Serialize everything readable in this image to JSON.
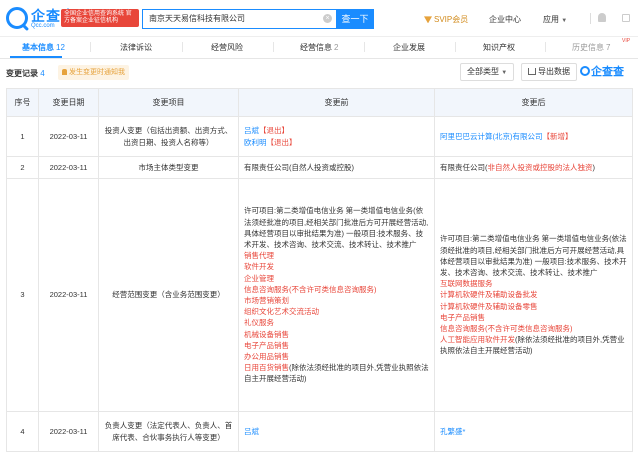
{
  "header": {
    "brand": "企查查",
    "brand_sub": "Qcc.com",
    "badge": "全国企业信用查询系统 官方备案企业征信机构",
    "search_value": "南京天天易信科技有限公司",
    "search_button": "查一下",
    "svip": "SVIP会员",
    "enterprise_center": "企业中心",
    "apps": "应用"
  },
  "tabs": [
    {
      "label": "基本信息",
      "count": "12"
    },
    {
      "label": "法律诉讼",
      "count": ""
    },
    {
      "label": "经营风险",
      "count": ""
    },
    {
      "label": "经营信息",
      "count": "2"
    },
    {
      "label": "企业发展",
      "count": ""
    },
    {
      "label": "知识产权",
      "count": ""
    },
    {
      "label": "历史信息",
      "count": "7"
    }
  ],
  "vip_tag": "VIP",
  "section": {
    "title": "变更记录",
    "count": "4",
    "notify": "发生变更时通知我",
    "filter": "全部类型",
    "export": "导出数据",
    "watermark": "企查查"
  },
  "table": {
    "headers": [
      "序号",
      "变更日期",
      "变更项目",
      "变更前",
      "变更后"
    ],
    "rows": [
      {
        "no": "1",
        "date": "2022-03-11",
        "item": "投资人变更（包括出资额、出资方式、出资日期、投资人名称等）",
        "before": [
          {
            "name": "吕斌",
            "tag": "【退出】"
          },
          {
            "name": "欧利明",
            "tag": "【退出】"
          }
        ],
        "after": [
          {
            "name": "阿里巴巴云计算(北京)有限公司",
            "tag": "【新增】"
          }
        ]
      },
      {
        "no": "2",
        "date": "2022-03-11",
        "item": "市场主体类型变更",
        "before_text": "有限责任公司(自然人投资或控股)",
        "after_prefix": "有限责任公司(",
        "after_hl": "非自然人投资或控股的法人独资",
        "after_suffix": ")"
      },
      {
        "no": "3",
        "date": "2022-03-11",
        "item": "经营范围变更（含业务范围变更）",
        "before_plain": "许可项目:第二类增值电信业务 第一类增值电信业务(依法须经批准的项目,经相关部门批准后方可开展经营活动,具体经营项目以审批结果为准) 一般项目:技术服务、技术开发、技术咨询、技术交流、技术转让、技术推广",
        "before_red": [
          "销售代理",
          "软件开发",
          "企业管理",
          "信息咨询服务(不含许可类信息咨询服务)",
          "市场营销策划",
          "组织文化艺术交流活动",
          "礼仪服务",
          "机械设备销售",
          "电子产品销售",
          "办公用品销售"
        ],
        "before_last_red": "日用百货销售",
        "before_tail": "(除依法须经批准的项目外,凭营业执照依法自主开展经营活动)",
        "after_plain": "许可项目:第二类增值电信业务 第一类增值电信业务(依法须经批准的项目,经相关部门批准后方可开展经营活动,具体经营项目以审批结果为准) 一般项目:技术服务、技术开发、技术咨询、技术交流、技术转让、技术推广",
        "after_red": [
          "互联网数据服务",
          "计算机软硬件及辅助设备批发",
          "计算机软硬件及辅助设备零售",
          "电子产品销售",
          "信息咨询服务(不含许可类信息咨询服务)"
        ],
        "after_last_red": "人工智能应用软件开发",
        "after_tail": "(除依法须经批准的项目外,凭营业执照依法自主开展经营活动)"
      },
      {
        "no": "4",
        "date": "2022-03-11",
        "item": "负责人变更（法定代表人、负责人、首席代表、合伙事务执行人等变更）",
        "before_text": "吕斌",
        "after_text": "孔繁盛*"
      }
    ]
  }
}
